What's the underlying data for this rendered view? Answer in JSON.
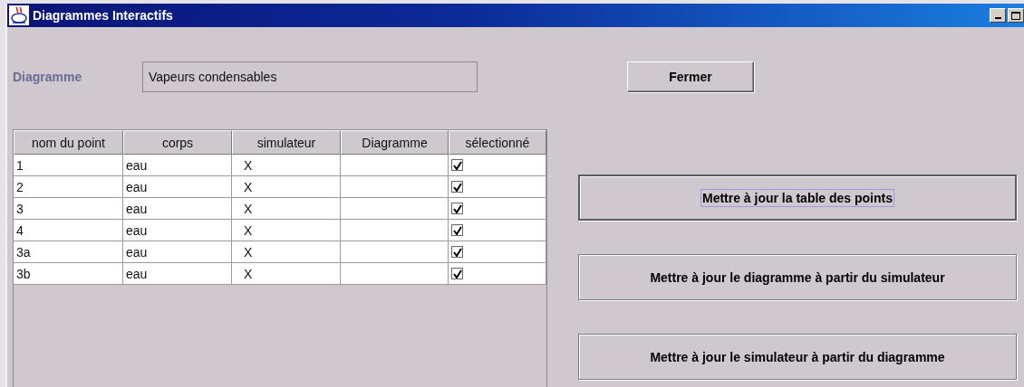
{
  "window": {
    "title": "Diagrammes Interactifs"
  },
  "diagram_field": {
    "label": "Diagramme",
    "value": "Vapeurs condensables"
  },
  "close_button": {
    "label": "Fermer"
  },
  "table": {
    "columns": [
      "nom du point",
      "corps",
      "simulateur",
      "Diagramme",
      "sélectionné"
    ],
    "rows": [
      {
        "point": "1",
        "corps": "eau",
        "simulateur": "X",
        "checked": true
      },
      {
        "point": "2",
        "corps": "eau",
        "simulateur": "X",
        "checked": true
      },
      {
        "point": "3",
        "corps": "eau",
        "simulateur": "X",
        "checked": true
      },
      {
        "point": "4",
        "corps": "eau",
        "simulateur": "X",
        "checked": true
      },
      {
        "point": "3a",
        "corps": "eau",
        "simulateur": "X",
        "checked": true
      },
      {
        "point": "3b",
        "corps": "eau",
        "simulateur": "X",
        "checked": true
      }
    ]
  },
  "actions": [
    {
      "label": "Mettre à jour la table des points",
      "focused": true
    },
    {
      "label": "Mettre à jour le diagramme à partir du simulateur",
      "focused": false
    },
    {
      "label": "Mettre à jour le simulateur à partir du diagramme",
      "focused": false
    }
  ]
}
